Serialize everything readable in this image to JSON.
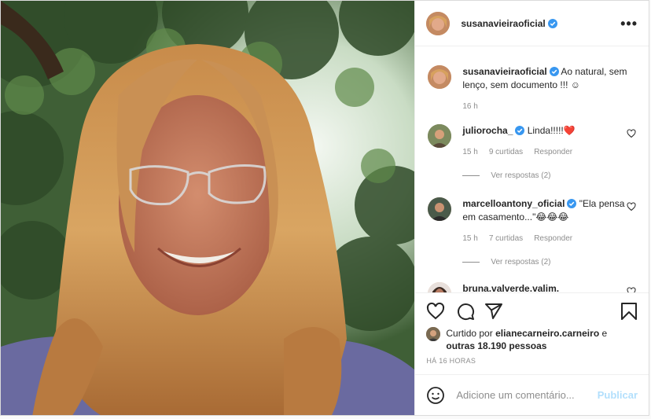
{
  "post": {
    "author": "susanavieiraoficial",
    "caption": "Ao natural, sem lenço, sem documento !!! ☺",
    "caption_time": "16 h"
  },
  "comments": [
    {
      "user": "juliorocha_",
      "text": "Linda!!!!!",
      "emoji": "❤️",
      "time": "15 h",
      "likes": "9 curtidas",
      "reply": "Responder",
      "view_replies": "Ver respostas (2)"
    },
    {
      "user": "marcelloantony_oficial",
      "text": "\"Ela pensa em casamento...\"",
      "emoji": "😂😂😂",
      "time": "15 h",
      "likes": "7 curtidas",
      "reply": "Responder",
      "view_replies": "Ver respostas (2)"
    },
    {
      "user": "bruna.valverde.valim._"
    }
  ],
  "likes": {
    "prefix": "Curtido por",
    "user": "elianecarneiro.carneiro",
    "joiner": "e",
    "others": "outras 18.190 pessoas"
  },
  "time_ago": "HÁ 16 HORAS",
  "add_comment": {
    "placeholder": "Adicione um comentário...",
    "publish": "Publicar"
  },
  "colors": {
    "verified": "#3897f0",
    "link_disabled": "#b2dffc",
    "secondary_text": "#8e8e8e"
  },
  "icons": [
    "more-icon",
    "heart-icon",
    "comment-icon",
    "share-icon",
    "bookmark-icon",
    "emoji-icon",
    "verified-icon"
  ]
}
